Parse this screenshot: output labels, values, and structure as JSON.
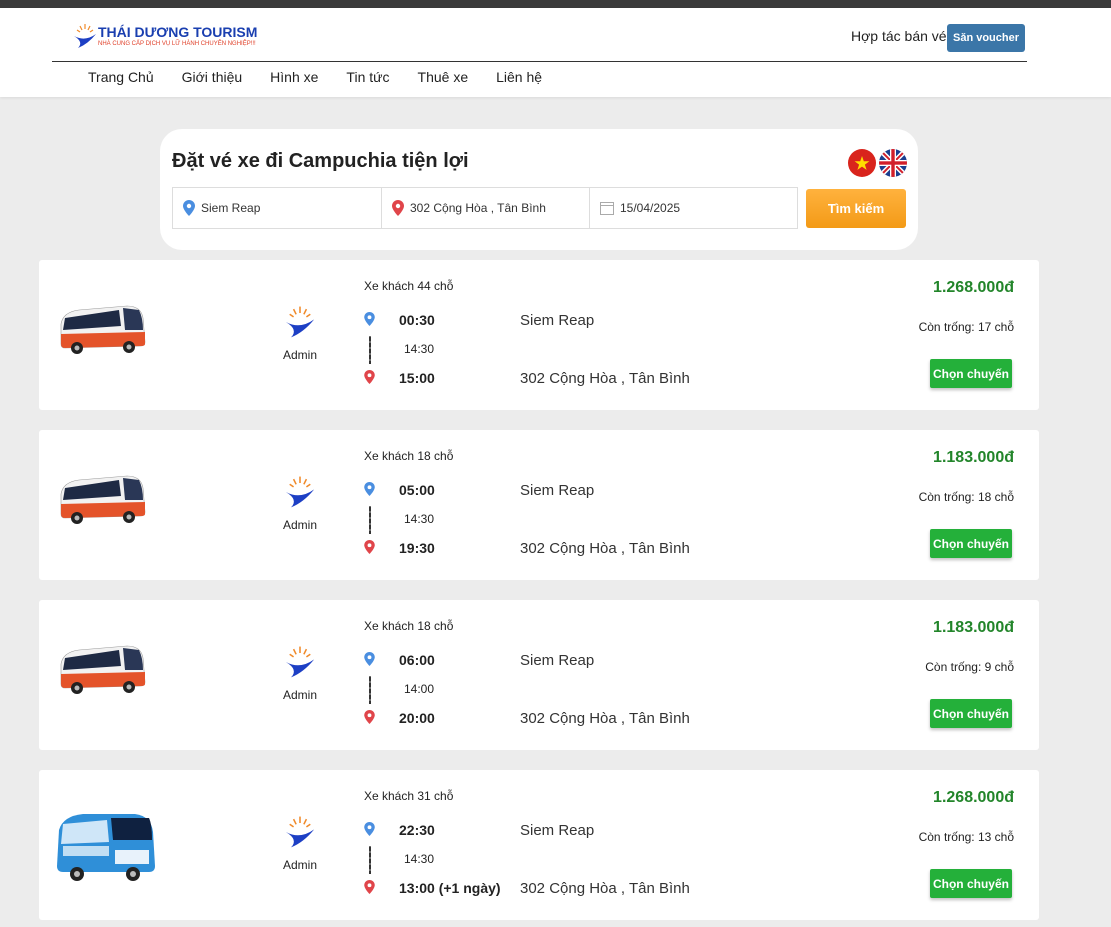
{
  "header": {
    "brand": "THÁI DƯƠNG TOURISM",
    "tagline": "NHÀ CUNG CẤP DỊCH VỤ LỮ HÀNH CHUYÊN NGHIỆP!!!",
    "partner_link": "Hợp tác bán vé",
    "voucher_button": "Săn voucher"
  },
  "nav": [
    "Trang Chủ",
    "Giới thiệu",
    "Hình xe",
    "Tin tức",
    "Thuê xe",
    "Liên hệ"
  ],
  "search": {
    "title": "Đặt vé xe đi Campuchia tiện lợi",
    "from": "Siem Reap",
    "to": "302 Cộng Hòa , Tân Bình",
    "date": "15/04/2025",
    "button": "Tìm kiếm"
  },
  "trips": [
    {
      "bus_type": "Xe khách 44 chỗ",
      "operator": "Admin",
      "depart_time": "00:30",
      "duration": "14:30",
      "arrive_time": "15:00",
      "from": "Siem Reap",
      "to": "302 Cộng Hòa , Tân Bình",
      "price": "1.268.000đ",
      "seats": "Còn trống: 17 chỗ",
      "button": "Chọn chuyến",
      "bus_style": "red"
    },
    {
      "bus_type": "Xe khách 18 chỗ",
      "operator": "Admin",
      "depart_time": "05:00",
      "duration": "14:30",
      "arrive_time": "19:30",
      "from": "Siem Reap",
      "to": "302 Cộng Hòa , Tân Bình",
      "price": "1.183.000đ",
      "seats": "Còn trống: 18 chỗ",
      "button": "Chọn chuyến",
      "bus_style": "red"
    },
    {
      "bus_type": "Xe khách 18 chỗ",
      "operator": "Admin",
      "depart_time": "06:00",
      "duration": "14:00",
      "arrive_time": "20:00",
      "from": "Siem Reap",
      "to": "302 Cộng Hòa , Tân Bình",
      "price": "1.183.000đ",
      "seats": "Còn trống: 9 chỗ",
      "button": "Chọn chuyến",
      "bus_style": "red"
    },
    {
      "bus_type": "Xe khách 31 chỗ",
      "operator": "Admin",
      "depart_time": "22:30",
      "duration": "14:30",
      "arrive_time": "13:00 (+1 ngày)",
      "from": "Siem Reap",
      "to": "302 Cộng Hòa , Tân Bình",
      "price": "1.268.000đ",
      "seats": "Còn trống: 13 chỗ",
      "button": "Chọn chuyến",
      "bus_style": "blue"
    }
  ],
  "colors": {
    "price": "#22852a",
    "choose_button": "#24b03a",
    "search_button": "#f39a16",
    "voucher_button": "#3b76a8"
  }
}
